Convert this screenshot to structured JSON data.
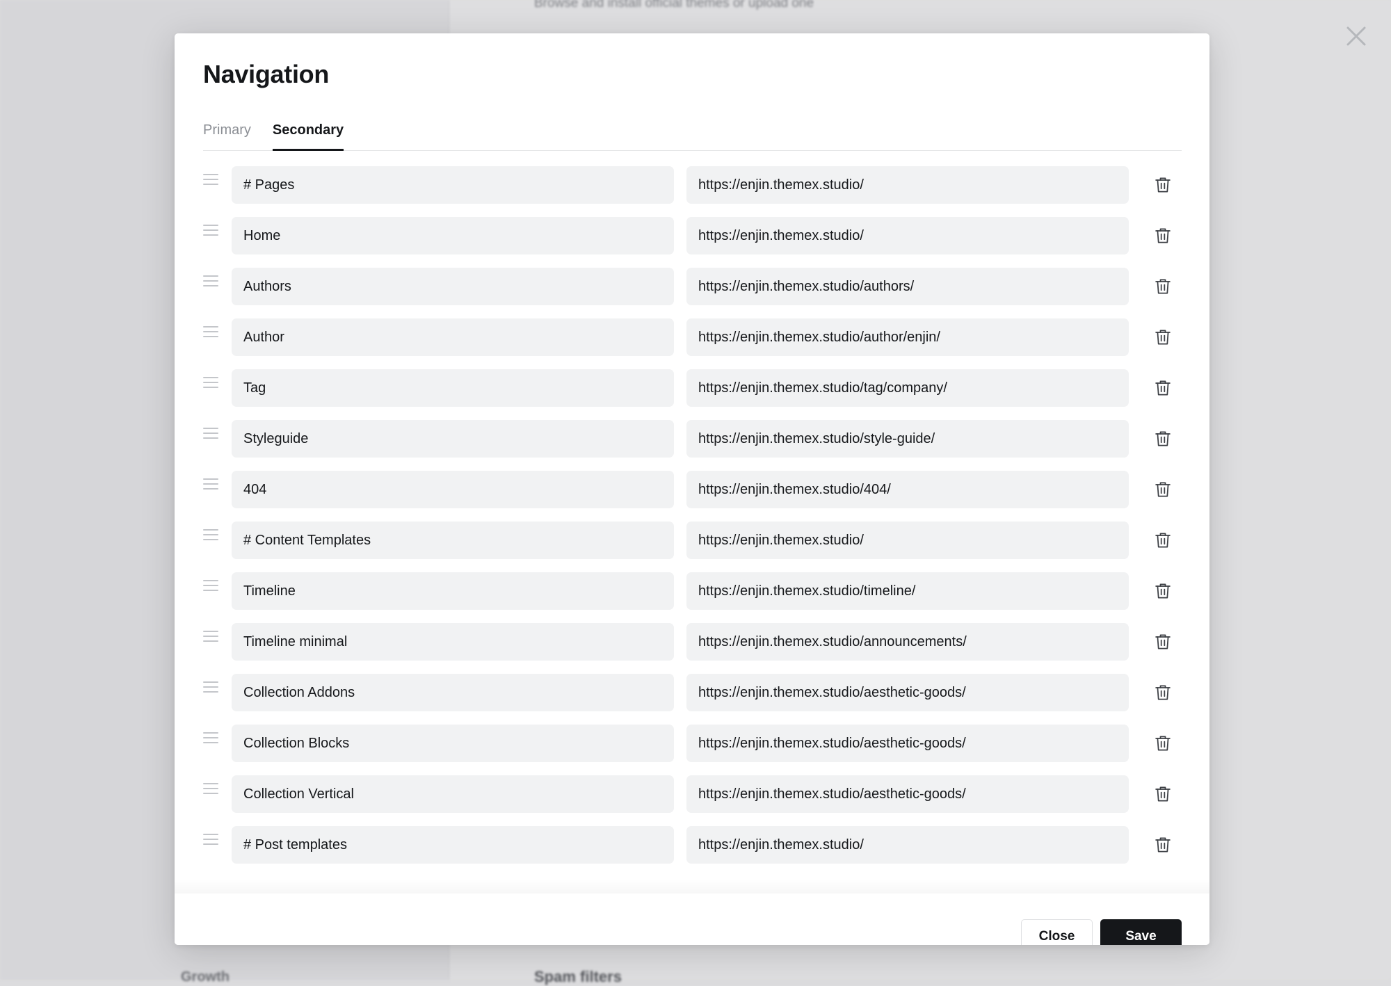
{
  "background": {
    "subtitle": "Browse and install official themes or upload one",
    "section_title": "Spam filters",
    "sidebar_item": "Growth"
  },
  "modal": {
    "title": "Navigation",
    "tabs": [
      {
        "label": "Primary",
        "active": false
      },
      {
        "label": "Secondary",
        "active": true
      }
    ],
    "items": [
      {
        "label": "# Pages",
        "url": "https://enjin.themex.studio/"
      },
      {
        "label": "Home",
        "url": "https://enjin.themex.studio/"
      },
      {
        "label": "Authors",
        "url": "https://enjin.themex.studio/authors/"
      },
      {
        "label": "Author",
        "url": "https://enjin.themex.studio/author/enjin/"
      },
      {
        "label": "Tag",
        "url": "https://enjin.themex.studio/tag/company/"
      },
      {
        "label": "Styleguide",
        "url": "https://enjin.themex.studio/style-guide/"
      },
      {
        "label": "404",
        "url": "https://enjin.themex.studio/404/"
      },
      {
        "label": "# Content Templates",
        "url": "https://enjin.themex.studio/"
      },
      {
        "label": "Timeline",
        "url": "https://enjin.themex.studio/timeline/"
      },
      {
        "label": "Timeline minimal",
        "url": "https://enjin.themex.studio/announcements/"
      },
      {
        "label": "Collection Addons",
        "url": "https://enjin.themex.studio/aesthetic-goods/"
      },
      {
        "label": "Collection Blocks",
        "url": "https://enjin.themex.studio/aesthetic-goods/"
      },
      {
        "label": "Collection Vertical",
        "url": "https://enjin.themex.studio/aesthetic-goods/"
      },
      {
        "label": "# Post templates",
        "url": "https://enjin.themex.studio/"
      }
    ],
    "buttons": {
      "close_label": "Close",
      "save_label": "Save"
    }
  },
  "icons": {
    "drag": "drag-handle-icon",
    "delete": "trash-icon",
    "close": "close-icon"
  },
  "colors": {
    "primary_button": "#15171a",
    "field_background": "#f1f2f3",
    "overlay_background": "#dcdcde"
  }
}
